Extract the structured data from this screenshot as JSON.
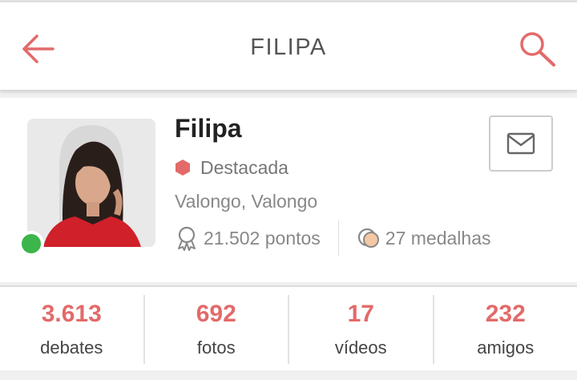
{
  "header": {
    "title": "FILIPA",
    "back_icon": "arrow-left-icon",
    "search_icon": "search-icon"
  },
  "colors": {
    "accent": "#e36a6a",
    "online": "#3cb54a"
  },
  "profile": {
    "name": "Filipa",
    "status": "online",
    "badge": "Destacada",
    "location": "Valongo, Valongo",
    "points": "21.502 pontos",
    "medals": "27 medalhas",
    "message_icon": "envelope-icon"
  },
  "counts": [
    {
      "value": "3.613",
      "label": "debates"
    },
    {
      "value": "692",
      "label": "fotos"
    },
    {
      "value": "17",
      "label": "vídeos"
    },
    {
      "value": "232",
      "label": "amigos"
    }
  ]
}
